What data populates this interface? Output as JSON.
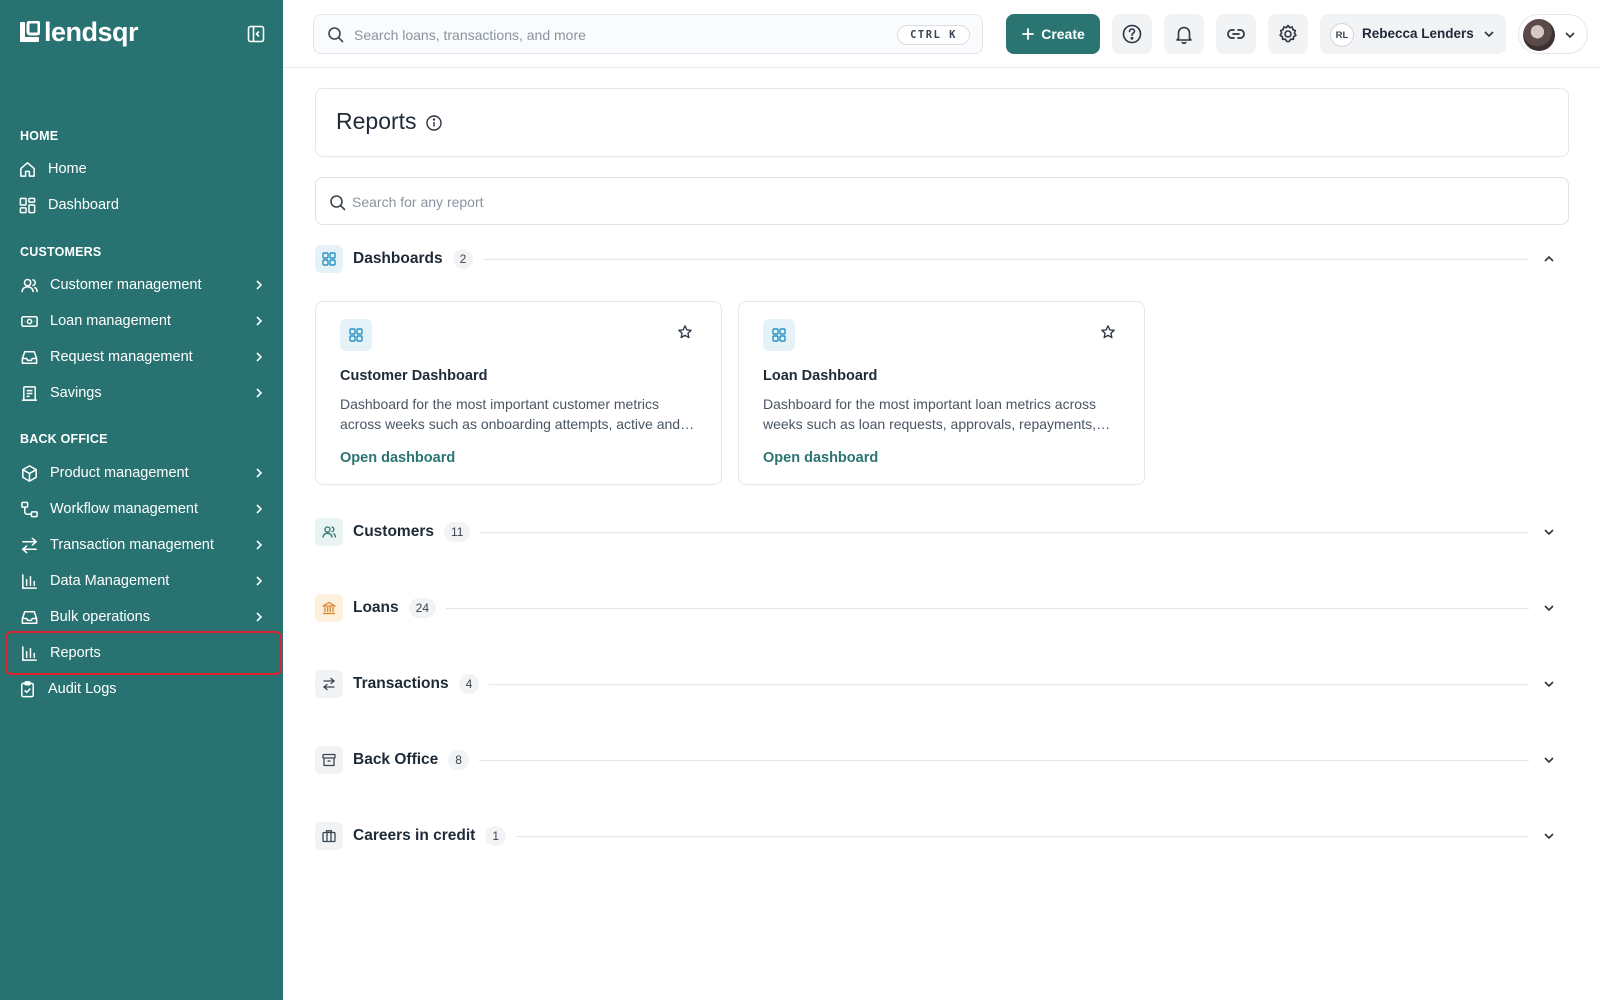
{
  "brand": {
    "name": "lendsqr"
  },
  "sidebar": {
    "sections": [
      {
        "label": "HOME"
      },
      {
        "label": "CUSTOMERS"
      },
      {
        "label": "BACK OFFICE"
      }
    ],
    "items": [
      {
        "label": "Home",
        "icon": "home-icon"
      },
      {
        "label": "Dashboard",
        "icon": "dashboard-grid-icon"
      },
      {
        "label": "Customer management",
        "icon": "users-icon"
      },
      {
        "label": "Loan management",
        "icon": "money-icon"
      },
      {
        "label": "Request management",
        "icon": "inbox-icon"
      },
      {
        "label": "Savings",
        "icon": "savings-icon"
      },
      {
        "label": "Product management",
        "icon": "box-icon"
      },
      {
        "label": "Workflow management",
        "icon": "workflow-icon"
      },
      {
        "label": "Transaction management",
        "icon": "transfer-icon"
      },
      {
        "label": "Data Management",
        "icon": "bar-chart-icon"
      },
      {
        "label": "Bulk operations",
        "icon": "inbox-icon"
      },
      {
        "label": "Reports",
        "icon": "bar-chart-icon"
      },
      {
        "label": "Audit Logs",
        "icon": "clipboard-check-icon"
      }
    ]
  },
  "topbar": {
    "search_placeholder": "Search loans, transactions, and more",
    "shortcut": "CTRL K",
    "create_label": "Create",
    "user": {
      "initials": "RL",
      "name": "Rebecca Lenders"
    }
  },
  "page": {
    "title": "Reports",
    "search_placeholder": "Search for any report"
  },
  "sections": [
    {
      "title": "Dashboards",
      "count": "2",
      "expanded": true,
      "color": "#e5f3f8"
    },
    {
      "title": "Customers",
      "count": "11",
      "expanded": false,
      "color": "#e8f4f1"
    },
    {
      "title": "Loans",
      "count": "24",
      "expanded": false,
      "color": "#fdf0dc"
    },
    {
      "title": "Transactions",
      "count": "4",
      "expanded": false,
      "color": "#f1f3f5"
    },
    {
      "title": "Back Office",
      "count": "8",
      "expanded": false,
      "color": "#f1f3f5"
    },
    {
      "title": "Careers in credit",
      "count": "1",
      "expanded": false,
      "color": "#f1f3f5"
    }
  ],
  "cards": [
    {
      "title": "Customer Dashboard",
      "description": "Dashboard for the most important customer metrics across weeks such as onboarding attempts, active and inactive customers",
      "link": "Open dashboard"
    },
    {
      "title": "Loan Dashboard",
      "description": "Dashboard for the most important loan metrics across weeks such as loan requests, approvals, repayments, disbursements",
      "link": "Open dashboard"
    }
  ],
  "colors": {
    "sidebar": "#287272",
    "accent": "#2a7472",
    "highlight_border": "#e0262d"
  }
}
